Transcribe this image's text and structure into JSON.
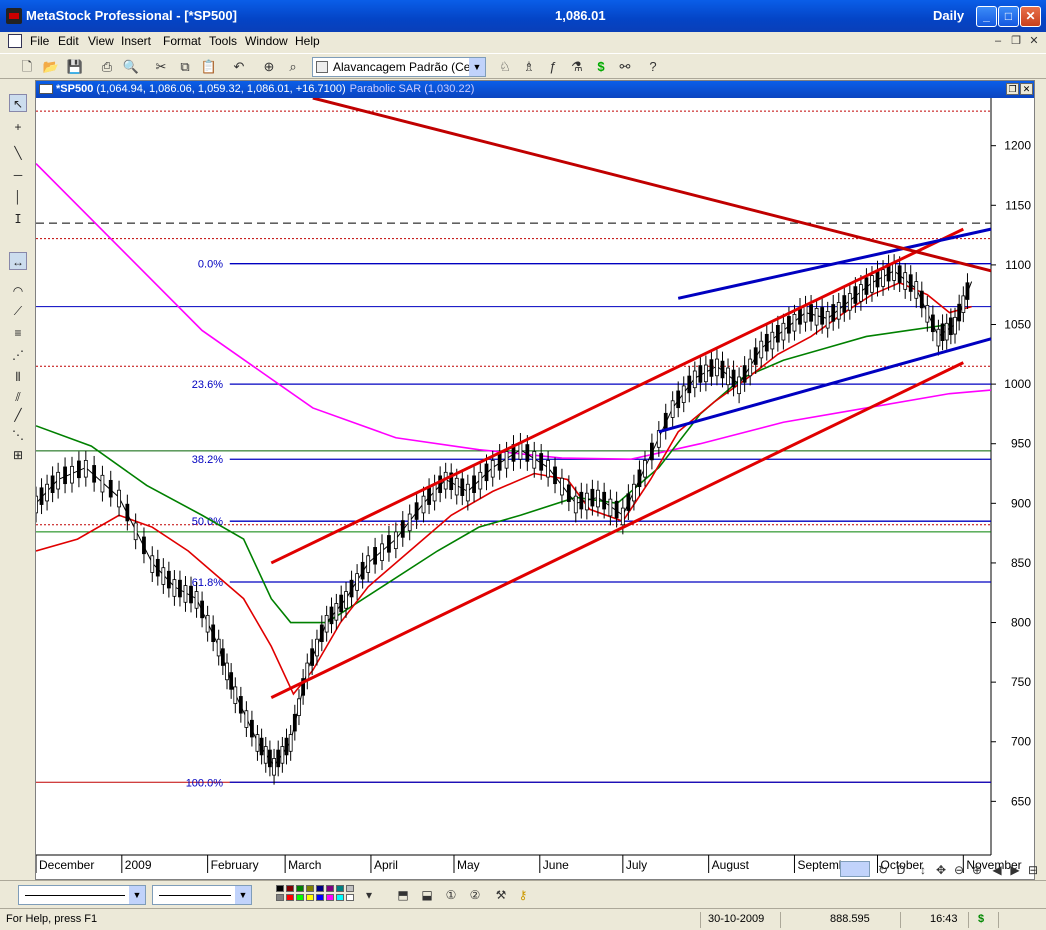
{
  "window": {
    "title": "MetaStock Professional - [*SP500]",
    "last_price": "1,086.01",
    "periodicity": "Daily"
  },
  "menu": [
    "File",
    "Edit",
    "View",
    "Insert",
    "Format",
    "Tools",
    "Window",
    "Help"
  ],
  "toolbar": {
    "template_combo": "Alavancagem Padrão (Cem)"
  },
  "chart_window": {
    "symbol": "*SP500",
    "ohlc": "(1,064.94, 1,086.06, 1,059.32, 1,086.01, +16.7100)",
    "indicator": "Parabolic SAR (1,030.22)"
  },
  "chart_data": {
    "type": "candlestick",
    "symbol": "*SP500",
    "ylim": [
      605,
      1240
    ],
    "y_ticks": [
      650,
      700,
      750,
      800,
      850,
      900,
      950,
      1000,
      1050,
      1100,
      1150,
      1200
    ],
    "x_labels": [
      "December",
      "2009",
      "February",
      "March",
      "April",
      "May",
      "June",
      "July",
      "August",
      "September",
      "October",
      "November"
    ],
    "x_range_days": [
      0,
      345
    ],
    "month_starts_day": [
      0,
      31,
      62,
      90,
      121,
      151,
      182,
      212,
      243,
      274,
      304,
      335
    ],
    "fibonacci": {
      "levels": [
        {
          "label": "0.0%",
          "value": 1101
        },
        {
          "label": "23.6%",
          "value": 1000
        },
        {
          "label": "38.2%",
          "value": 937
        },
        {
          "label": "50.0%",
          "value": 885
        },
        {
          "label": "61.8%",
          "value": 834
        },
        {
          "label": "100.0%",
          "value": 666
        }
      ],
      "color": "#0000c0"
    },
    "horizontal_lines": [
      {
        "value": 1065,
        "color": "#0000c0",
        "style": "solid"
      },
      {
        "value": 944,
        "color": "#006000",
        "style": "solid"
      },
      {
        "value": 876,
        "color": "#008000",
        "style": "solid"
      },
      {
        "value": 666,
        "color": "#c00000",
        "style": "solid"
      },
      {
        "value": 1135,
        "color": "#000000",
        "style": "dashed"
      },
      {
        "value": 1229,
        "color": "#c00000",
        "style": "dotted"
      },
      {
        "value": 1122,
        "color": "#c00000",
        "style": "dotted"
      },
      {
        "value": 1015,
        "color": "#c00000",
        "style": "dotted"
      },
      {
        "value": 882,
        "color": "#c00000",
        "style": "dotted"
      }
    ],
    "series": [
      {
        "kind": "moving-average",
        "color": "#ff00ff",
        "points": [
          [
            0,
            1185
          ],
          [
            60,
            1045
          ],
          [
            100,
            980
          ],
          [
            130,
            955
          ],
          [
            160,
            945
          ],
          [
            190,
            938
          ],
          [
            215,
            937
          ],
          [
            240,
            950
          ],
          [
            270,
            968
          ],
          [
            300,
            980
          ],
          [
            330,
            992
          ],
          [
            345,
            995
          ]
        ]
      },
      {
        "kind": "moving-average",
        "color": "#008000",
        "points": [
          [
            0,
            965
          ],
          [
            20,
            948
          ],
          [
            40,
            915
          ],
          [
            60,
            890
          ],
          [
            75,
            870
          ],
          [
            85,
            820
          ],
          [
            92,
            800
          ],
          [
            105,
            800
          ],
          [
            125,
            830
          ],
          [
            145,
            860
          ],
          [
            160,
            880
          ],
          [
            175,
            890
          ],
          [
            195,
            905
          ],
          [
            210,
            900
          ],
          [
            225,
            930
          ],
          [
            240,
            975
          ],
          [
            255,
            1005
          ],
          [
            270,
            1020
          ],
          [
            285,
            1030
          ],
          [
            300,
            1040
          ],
          [
            315,
            1045
          ],
          [
            330,
            1050
          ]
        ]
      },
      {
        "kind": "moving-average",
        "color": "#e00000",
        "points": [
          [
            0,
            860
          ],
          [
            15,
            870
          ],
          [
            30,
            890
          ],
          [
            42,
            880
          ],
          [
            55,
            860
          ],
          [
            65,
            840
          ],
          [
            75,
            820
          ],
          [
            85,
            780
          ],
          [
            93,
            740
          ],
          [
            100,
            760
          ],
          [
            110,
            800
          ],
          [
            120,
            830
          ],
          [
            135,
            860
          ],
          [
            150,
            890
          ],
          [
            165,
            910
          ],
          [
            180,
            925
          ],
          [
            192,
            920
          ],
          [
            200,
            895
          ],
          [
            212,
            885
          ],
          [
            222,
            920
          ],
          [
            232,
            960
          ],
          [
            245,
            985
          ],
          [
            257,
            1005
          ],
          [
            268,
            1025
          ],
          [
            280,
            1040
          ],
          [
            292,
            1060
          ],
          [
            302,
            1075
          ],
          [
            312,
            1085
          ],
          [
            322,
            1075
          ],
          [
            330,
            1060
          ],
          [
            338,
            1065
          ]
        ]
      },
      {
        "kind": "close",
        "color": "#000000",
        "points": [
          [
            0,
            900
          ],
          [
            8,
            920
          ],
          [
            18,
            930
          ],
          [
            30,
            905
          ],
          [
            42,
            850
          ],
          [
            50,
            830
          ],
          [
            58,
            820
          ],
          [
            66,
            780
          ],
          [
            72,
            740
          ],
          [
            80,
            700
          ],
          [
            86,
            680
          ],
          [
            92,
            700
          ],
          [
            98,
            760
          ],
          [
            105,
            800
          ],
          [
            112,
            820
          ],
          [
            120,
            850
          ],
          [
            130,
            870
          ],
          [
            140,
            900
          ],
          [
            148,
            920
          ],
          [
            156,
            910
          ],
          [
            165,
            930
          ],
          [
            175,
            945
          ],
          [
            185,
            930
          ],
          [
            195,
            900
          ],
          [
            203,
            905
          ],
          [
            212,
            890
          ],
          [
            220,
            930
          ],
          [
            230,
            980
          ],
          [
            238,
            1005
          ],
          [
            246,
            1015
          ],
          [
            254,
            1000
          ],
          [
            262,
            1030
          ],
          [
            270,
            1045
          ],
          [
            278,
            1060
          ],
          [
            286,
            1055
          ],
          [
            294,
            1070
          ],
          [
            302,
            1085
          ],
          [
            310,
            1095
          ],
          [
            318,
            1080
          ],
          [
            326,
            1040
          ],
          [
            332,
            1050
          ],
          [
            338,
            1086
          ]
        ]
      }
    ],
    "trend_channels": [
      {
        "color": "#e00000",
        "points": [
          [
            85,
            737
          ],
          [
            335,
            1018
          ]
        ]
      },
      {
        "color": "#e00000",
        "points": [
          [
            85,
            850
          ],
          [
            335,
            1130
          ]
        ]
      },
      {
        "color": "#0000c0",
        "points": [
          [
            225,
            960
          ],
          [
            345,
            1038
          ]
        ]
      },
      {
        "color": "#0000c0",
        "points": [
          [
            232,
            1072
          ],
          [
            345,
            1130
          ]
        ]
      },
      {
        "color": "#c00000",
        "points": [
          [
            100,
            1240
          ],
          [
            345,
            1095
          ]
        ]
      }
    ]
  },
  "bottom_toolbar": {
    "palette": [
      "#000000",
      "#800000",
      "#008000",
      "#808000",
      "#000080",
      "#800080",
      "#008080",
      "#c0c0c0",
      "#808080",
      "#ff0000",
      "#00ff00",
      "#ffff00",
      "#0000ff",
      "#ff00ff",
      "#00ffff",
      "#ffffff"
    ]
  },
  "statusbar": {
    "help": "For Help, press F1",
    "date": "30-10-2009",
    "cursor_value": "888.595",
    "time": "16:43",
    "dollar": "$"
  }
}
